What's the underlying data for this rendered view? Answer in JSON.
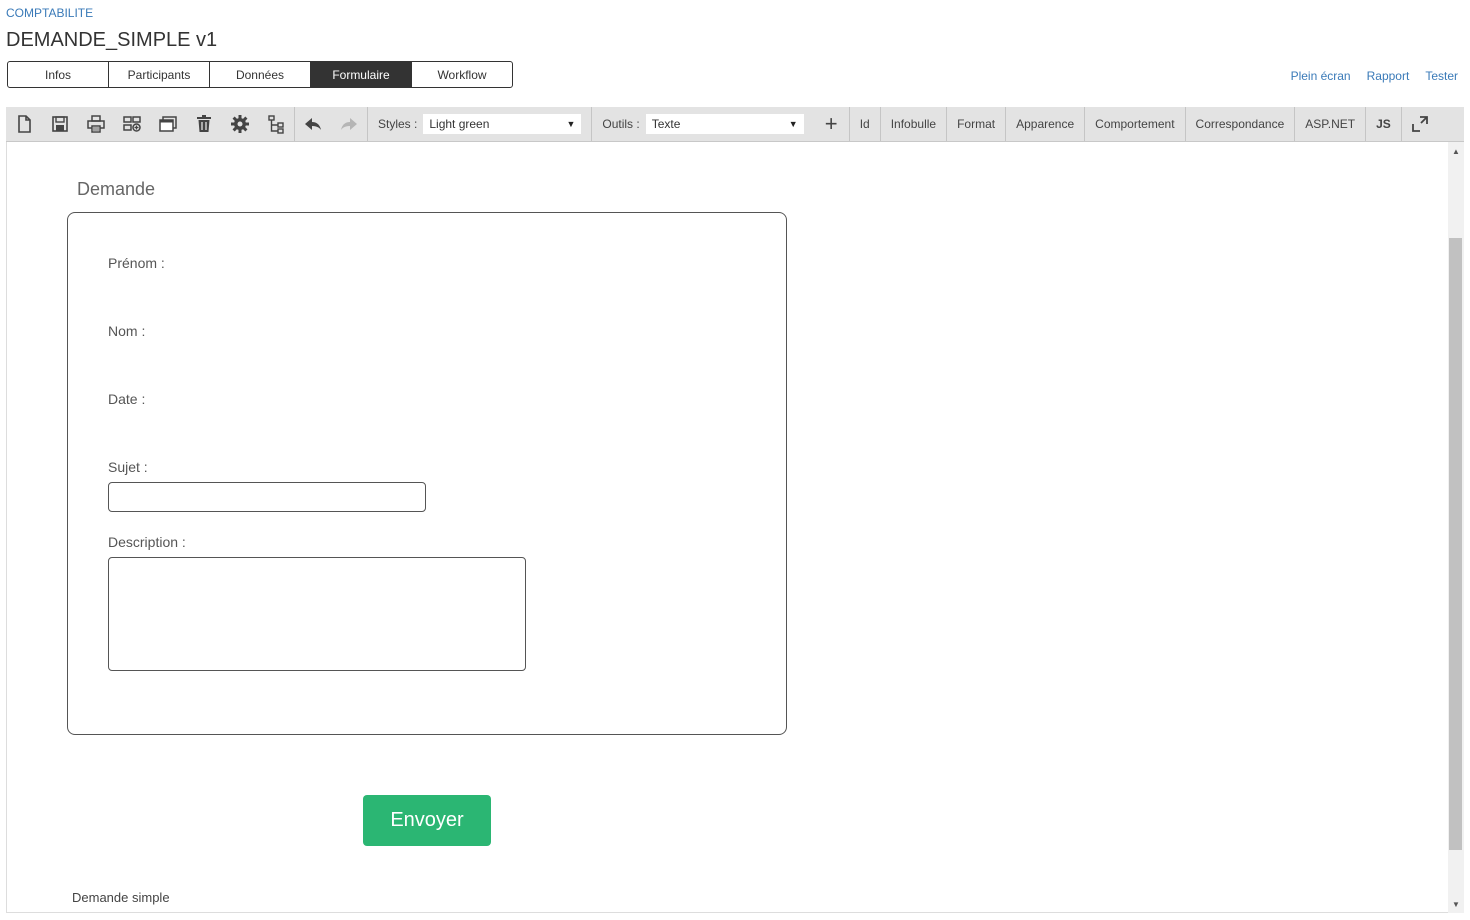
{
  "breadcrumb": "COMPTABILITE",
  "title": "DEMANDE_SIMPLE v1",
  "tabs": [
    {
      "label": "Infos"
    },
    {
      "label": "Participants"
    },
    {
      "label": "Données"
    },
    {
      "label": "Formulaire",
      "active": true
    },
    {
      "label": "Workflow"
    }
  ],
  "top_links": {
    "fullscreen": "Plein écran",
    "report": "Rapport",
    "test": "Tester"
  },
  "toolbar": {
    "icons": [
      "new-document-icon",
      "save-icon",
      "print-icon",
      "add-section-icon",
      "window-icon",
      "delete-icon",
      "settings-icon",
      "tree-icon",
      "undo-icon",
      "redo-icon"
    ],
    "styles_label": "Styles :",
    "styles_value": "Light green",
    "tools_label": "Outils :",
    "tools_value": "Texte",
    "items": [
      "Id",
      "Infobulle",
      "Format",
      "Apparence",
      "Comportement",
      "Correspondance",
      "ASP.NET",
      "JS"
    ]
  },
  "form": {
    "legend": "Demande",
    "fields": {
      "prenom": "Prénom :",
      "nom": "Nom :",
      "date": "Date :",
      "sujet": "Sujet :",
      "description": "Description :"
    },
    "sujet_value": "",
    "description_value": "",
    "submit_label": "Envoyer"
  },
  "footer_text": "Demande simple",
  "colors": {
    "accent": "#2bb673",
    "link": "#3a7ab8",
    "active_tab": "#333333",
    "toolbar_bg": "#e3e3e3"
  }
}
